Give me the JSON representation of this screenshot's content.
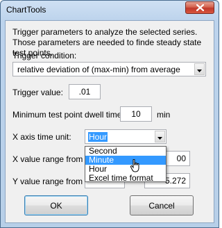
{
  "window": {
    "title": "ChartTools"
  },
  "description": "Trigger parameters to analyze the selected series. Those parameters are needed to finde steady state test points.",
  "trigger_condition": {
    "label": "Trigger condition:",
    "value": "relative deviation of (max-min) from average"
  },
  "trigger_value": {
    "label": "Trigger value:",
    "value": ".01"
  },
  "dwell_time": {
    "label": "Minimum test point dwell time:",
    "value": "10",
    "unit": "min"
  },
  "x_axis_unit": {
    "label": "X axis time unit:",
    "value": "Hour",
    "options": [
      "Second",
      "Minute",
      "Hour",
      "Excel time format"
    ],
    "highlighted": "Minute"
  },
  "x_range": {
    "label": "X value range from",
    "to_value_partial": "00"
  },
  "y_range": {
    "label": "Y value range from",
    "to_value_partial": "5.272"
  },
  "buttons": {
    "ok": "OK",
    "cancel": "Cancel"
  },
  "icons": {
    "close": "close-icon",
    "dropdown": "chevron-down-icon",
    "cursor": "mouse-pointer-icon"
  }
}
